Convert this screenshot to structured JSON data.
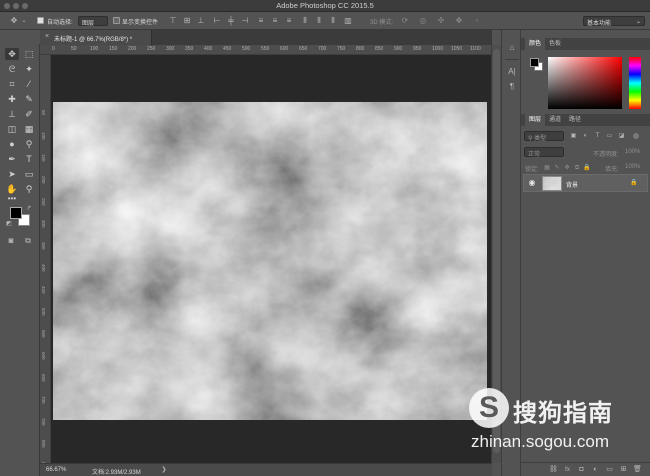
{
  "app_title": "Adobe Photoshop CC 2015.5",
  "options_bar": {
    "auto_select_label": "自动选择:",
    "auto_select_value": "图层",
    "show_transform_label": "显示变换控件",
    "mode_3d_label": "3D 模式:",
    "workspace_value": "基本功能"
  },
  "document_tab": {
    "title": "未标题-1 @ 66.7%(RGB/8*) *",
    "close_glyph": "×"
  },
  "ruler_top": [
    "0",
    "50",
    "100",
    "150",
    "200",
    "250",
    "300",
    "350",
    "400",
    "450",
    "500",
    "550",
    "600",
    "650",
    "700",
    "750",
    "800",
    "850",
    "900",
    "950",
    "1000",
    "1050",
    "1100"
  ],
  "ruler_left": [
    "50",
    "100",
    "150",
    "200",
    "250",
    "300",
    "350",
    "400",
    "450",
    "500",
    "550",
    "600",
    "650",
    "700",
    "750",
    "800",
    "850"
  ],
  "status_bar": {
    "zoom": "66.67%",
    "doc_info": "文档:2.93M/2.93M"
  },
  "color_panel": {
    "tabs": [
      "颜色",
      "色板"
    ],
    "hue_gradient_colors": [
      "#ff0000",
      "#ff00ff",
      "#0000ff",
      "#00ffff",
      "#00ff00",
      "#ffff00",
      "#ff0000"
    ],
    "picker_color": "#ff0000"
  },
  "layers_panel": {
    "tabs": [
      "图层",
      "通道",
      "路径"
    ],
    "filter_placeholder": "类型",
    "blend_mode": "正常",
    "opacity_label": "不透明度:",
    "opacity_value": "100%",
    "lock_label": "锁定:",
    "fill_label": "填充:",
    "fill_value": "100%",
    "layer": {
      "name": "背景",
      "visible": true,
      "locked": true
    },
    "bottom_icons": [
      "link-icon",
      "fx-icon",
      "mask-icon",
      "adjustment-icon",
      "folder-icon",
      "new-layer-icon",
      "trash-icon"
    ]
  },
  "colors": {
    "foreground": "#000000",
    "background": "#ffffff"
  },
  "watermark": {
    "brand": "搜狗指南",
    "url": "zhinan.sogou.com"
  }
}
